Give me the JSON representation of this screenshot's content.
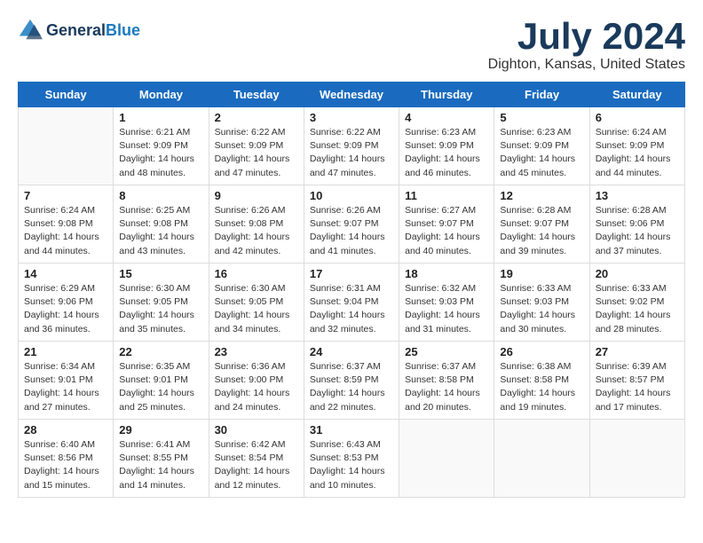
{
  "logo": {
    "text_general": "General",
    "text_blue": "Blue"
  },
  "title": {
    "month": "July 2024",
    "location": "Dighton, Kansas, United States"
  },
  "headers": [
    "Sunday",
    "Monday",
    "Tuesday",
    "Wednesday",
    "Thursday",
    "Friday",
    "Saturday"
  ],
  "weeks": [
    [
      {
        "day": "",
        "sunrise": "",
        "sunset": "",
        "daylight": "",
        "empty": true
      },
      {
        "day": "1",
        "sunrise": "Sunrise: 6:21 AM",
        "sunset": "Sunset: 9:09 PM",
        "daylight": "Daylight: 14 hours and 48 minutes."
      },
      {
        "day": "2",
        "sunrise": "Sunrise: 6:22 AM",
        "sunset": "Sunset: 9:09 PM",
        "daylight": "Daylight: 14 hours and 47 minutes."
      },
      {
        "day": "3",
        "sunrise": "Sunrise: 6:22 AM",
        "sunset": "Sunset: 9:09 PM",
        "daylight": "Daylight: 14 hours and 47 minutes."
      },
      {
        "day": "4",
        "sunrise": "Sunrise: 6:23 AM",
        "sunset": "Sunset: 9:09 PM",
        "daylight": "Daylight: 14 hours and 46 minutes."
      },
      {
        "day": "5",
        "sunrise": "Sunrise: 6:23 AM",
        "sunset": "Sunset: 9:09 PM",
        "daylight": "Daylight: 14 hours and 45 minutes."
      },
      {
        "day": "6",
        "sunrise": "Sunrise: 6:24 AM",
        "sunset": "Sunset: 9:09 PM",
        "daylight": "Daylight: 14 hours and 44 minutes."
      }
    ],
    [
      {
        "day": "7",
        "sunrise": "Sunrise: 6:24 AM",
        "sunset": "Sunset: 9:08 PM",
        "daylight": "Daylight: 14 hours and 44 minutes."
      },
      {
        "day": "8",
        "sunrise": "Sunrise: 6:25 AM",
        "sunset": "Sunset: 9:08 PM",
        "daylight": "Daylight: 14 hours and 43 minutes."
      },
      {
        "day": "9",
        "sunrise": "Sunrise: 6:26 AM",
        "sunset": "Sunset: 9:08 PM",
        "daylight": "Daylight: 14 hours and 42 minutes."
      },
      {
        "day": "10",
        "sunrise": "Sunrise: 6:26 AM",
        "sunset": "Sunset: 9:07 PM",
        "daylight": "Daylight: 14 hours and 41 minutes."
      },
      {
        "day": "11",
        "sunrise": "Sunrise: 6:27 AM",
        "sunset": "Sunset: 9:07 PM",
        "daylight": "Daylight: 14 hours and 40 minutes."
      },
      {
        "day": "12",
        "sunrise": "Sunrise: 6:28 AM",
        "sunset": "Sunset: 9:07 PM",
        "daylight": "Daylight: 14 hours and 39 minutes."
      },
      {
        "day": "13",
        "sunrise": "Sunrise: 6:28 AM",
        "sunset": "Sunset: 9:06 PM",
        "daylight": "Daylight: 14 hours and 37 minutes."
      }
    ],
    [
      {
        "day": "14",
        "sunrise": "Sunrise: 6:29 AM",
        "sunset": "Sunset: 9:06 PM",
        "daylight": "Daylight: 14 hours and 36 minutes."
      },
      {
        "day": "15",
        "sunrise": "Sunrise: 6:30 AM",
        "sunset": "Sunset: 9:05 PM",
        "daylight": "Daylight: 14 hours and 35 minutes."
      },
      {
        "day": "16",
        "sunrise": "Sunrise: 6:30 AM",
        "sunset": "Sunset: 9:05 PM",
        "daylight": "Daylight: 14 hours and 34 minutes."
      },
      {
        "day": "17",
        "sunrise": "Sunrise: 6:31 AM",
        "sunset": "Sunset: 9:04 PM",
        "daylight": "Daylight: 14 hours and 32 minutes."
      },
      {
        "day": "18",
        "sunrise": "Sunrise: 6:32 AM",
        "sunset": "Sunset: 9:03 PM",
        "daylight": "Daylight: 14 hours and 31 minutes."
      },
      {
        "day": "19",
        "sunrise": "Sunrise: 6:33 AM",
        "sunset": "Sunset: 9:03 PM",
        "daylight": "Daylight: 14 hours and 30 minutes."
      },
      {
        "day": "20",
        "sunrise": "Sunrise: 6:33 AM",
        "sunset": "Sunset: 9:02 PM",
        "daylight": "Daylight: 14 hours and 28 minutes."
      }
    ],
    [
      {
        "day": "21",
        "sunrise": "Sunrise: 6:34 AM",
        "sunset": "Sunset: 9:01 PM",
        "daylight": "Daylight: 14 hours and 27 minutes."
      },
      {
        "day": "22",
        "sunrise": "Sunrise: 6:35 AM",
        "sunset": "Sunset: 9:01 PM",
        "daylight": "Daylight: 14 hours and 25 minutes."
      },
      {
        "day": "23",
        "sunrise": "Sunrise: 6:36 AM",
        "sunset": "Sunset: 9:00 PM",
        "daylight": "Daylight: 14 hours and 24 minutes."
      },
      {
        "day": "24",
        "sunrise": "Sunrise: 6:37 AM",
        "sunset": "Sunset: 8:59 PM",
        "daylight": "Daylight: 14 hours and 22 minutes."
      },
      {
        "day": "25",
        "sunrise": "Sunrise: 6:37 AM",
        "sunset": "Sunset: 8:58 PM",
        "daylight": "Daylight: 14 hours and 20 minutes."
      },
      {
        "day": "26",
        "sunrise": "Sunrise: 6:38 AM",
        "sunset": "Sunset: 8:58 PM",
        "daylight": "Daylight: 14 hours and 19 minutes."
      },
      {
        "day": "27",
        "sunrise": "Sunrise: 6:39 AM",
        "sunset": "Sunset: 8:57 PM",
        "daylight": "Daylight: 14 hours and 17 minutes."
      }
    ],
    [
      {
        "day": "28",
        "sunrise": "Sunrise: 6:40 AM",
        "sunset": "Sunset: 8:56 PM",
        "daylight": "Daylight: 14 hours and 15 minutes."
      },
      {
        "day": "29",
        "sunrise": "Sunrise: 6:41 AM",
        "sunset": "Sunset: 8:55 PM",
        "daylight": "Daylight: 14 hours and 14 minutes."
      },
      {
        "day": "30",
        "sunrise": "Sunrise: 6:42 AM",
        "sunset": "Sunset: 8:54 PM",
        "daylight": "Daylight: 14 hours and 12 minutes."
      },
      {
        "day": "31",
        "sunrise": "Sunrise: 6:43 AM",
        "sunset": "Sunset: 8:53 PM",
        "daylight": "Daylight: 14 hours and 10 minutes."
      },
      {
        "day": "",
        "sunrise": "",
        "sunset": "",
        "daylight": "",
        "empty": true
      },
      {
        "day": "",
        "sunrise": "",
        "sunset": "",
        "daylight": "",
        "empty": true
      },
      {
        "day": "",
        "sunrise": "",
        "sunset": "",
        "daylight": "",
        "empty": true
      }
    ]
  ]
}
